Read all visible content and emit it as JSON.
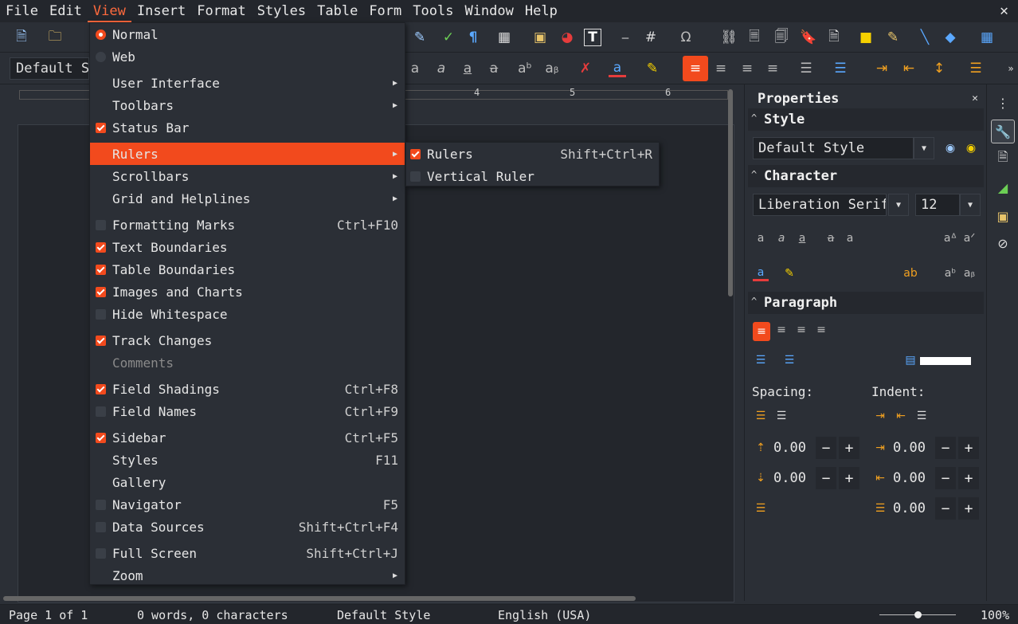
{
  "menubar": {
    "items": [
      "File",
      "Edit",
      "View",
      "Insert",
      "Format",
      "Styles",
      "Table",
      "Form",
      "Tools",
      "Window",
      "Help"
    ],
    "active": "View",
    "close_symbol": "✕"
  },
  "toolbar": {
    "paragraph_style": "Default Style"
  },
  "ruler": {
    "numbers": [
      "4",
      "5",
      "6"
    ]
  },
  "view_menu": {
    "items": [
      {
        "label": "Normal",
        "mark": "radio-on"
      },
      {
        "label": "Web",
        "mark": "radio-off"
      },
      {
        "label": "User Interface",
        "submenu": true
      },
      {
        "label": "Toolbars",
        "submenu": true
      },
      {
        "label": "Status Bar",
        "mark": "check-on"
      },
      {
        "label": "Rulers",
        "submenu": true,
        "highlighted": true
      },
      {
        "label": "Scrollbars",
        "submenu": true
      },
      {
        "label": "Grid and Helplines",
        "submenu": true
      },
      {
        "label": "Formatting Marks",
        "mark": "check-off",
        "shortcut": "Ctrl+F10"
      },
      {
        "label": "Text Boundaries",
        "mark": "check-on"
      },
      {
        "label": "Table Boundaries",
        "mark": "check-on"
      },
      {
        "label": "Images and Charts",
        "mark": "check-on"
      },
      {
        "label": "Hide Whitespace",
        "mark": "check-off"
      },
      {
        "label": "Track Changes",
        "mark": "check-on"
      },
      {
        "label": "Comments",
        "disabled": true
      },
      {
        "label": "Field Shadings",
        "mark": "check-on",
        "shortcut": "Ctrl+F8"
      },
      {
        "label": "Field Names",
        "mark": "check-off",
        "shortcut": "Ctrl+F9"
      },
      {
        "label": "Sidebar",
        "mark": "check-on",
        "shortcut": "Ctrl+F5"
      },
      {
        "label": "Styles",
        "shortcut": "F11"
      },
      {
        "label": "Gallery"
      },
      {
        "label": "Navigator",
        "mark": "check-off",
        "shortcut": "F5"
      },
      {
        "label": "Data Sources",
        "mark": "check-off",
        "shortcut": "Shift+Ctrl+F4"
      },
      {
        "label": "Full Screen",
        "mark": "check-off",
        "shortcut": "Shift+Ctrl+J"
      },
      {
        "label": "Zoom",
        "submenu": true
      }
    ]
  },
  "rulers_submenu": {
    "items": [
      {
        "label": "Rulers",
        "mark": "check-on",
        "shortcut": "Shift+Ctrl+R"
      },
      {
        "label": "Vertical Ruler",
        "mark": "check-off"
      }
    ]
  },
  "sidebar": {
    "title": "Properties",
    "style_section": "Style",
    "style_value": "Default Style",
    "character_section": "Character",
    "font_name": "Liberation Serif",
    "font_size": "12",
    "paragraph_section": "Paragraph",
    "spacing_label": "Spacing:",
    "indent_label": "Indent:",
    "spacing_above": "0.00",
    "spacing_below": "0.00",
    "indent_before": "0.00",
    "indent_after": "0.00",
    "first_line": "0.00"
  },
  "statusbar": {
    "page": "Page 1 of 1",
    "words": "0 words, 0 characters",
    "style": "Default Style",
    "language": "English (USA)",
    "zoom": "100%",
    "zoom_level": 1.0
  },
  "colors": {
    "accent": "#f24a1d",
    "background": "#2b2f36",
    "menubar": "#23262c"
  }
}
